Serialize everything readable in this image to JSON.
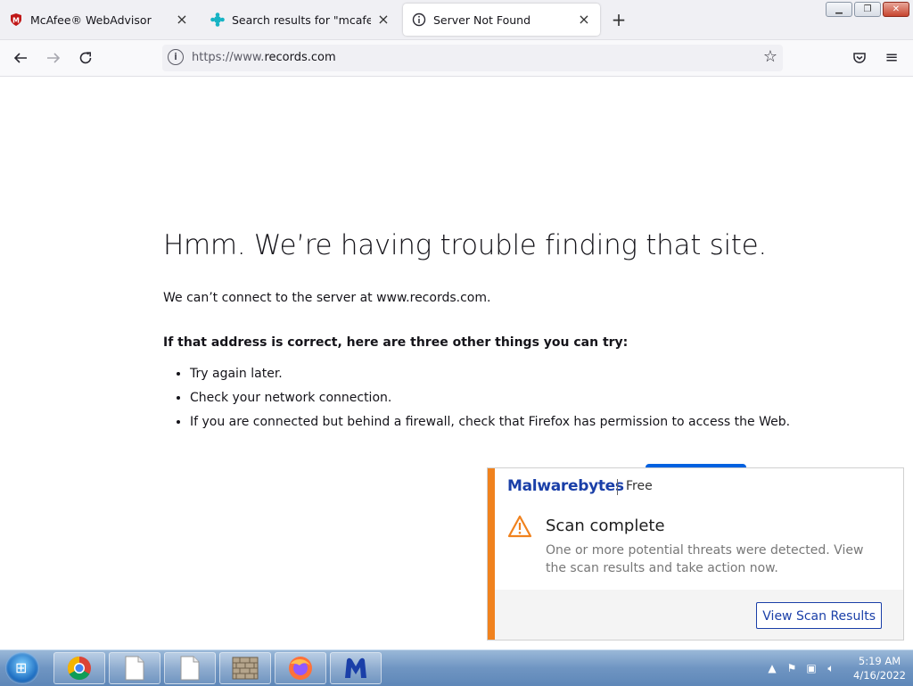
{
  "browser": {
    "tabs": [
      {
        "title": "McAfee® WebAdvisor",
        "favicon": "mcafee-shield-icon",
        "active": false
      },
      {
        "title": "Search results for \"mcafee\" – Ad",
        "favicon": "puzzle-icon",
        "active": false
      },
      {
        "title": "Server Not Found",
        "favicon": "info-circle-icon",
        "active": true
      }
    ],
    "url": {
      "prefix": "https://www.",
      "host": "records.com"
    }
  },
  "error_page": {
    "title": "Hmm. We’re having trouble finding that site.",
    "description": "We can’t connect to the server at www.records.com.",
    "tips_heading": "If that address is correct, here are three other things you can try:",
    "tips": [
      "Try again later.",
      "Check your network connection.",
      "If you are connected but behind a firewall, check that Firefox has permission to access the Web."
    ]
  },
  "notification": {
    "brand": "Malwarebytes",
    "edition": "Free",
    "heading": "Scan complete",
    "body": "One or more potential threats were detected. View the scan results and take action now.",
    "button": "View Scan Results",
    "accent_color": "#f0821e",
    "brand_color": "#1a3fa8"
  },
  "taskbar": {
    "items": [
      "chrome-icon",
      "document-icon",
      "document-icon",
      "firewall-icon",
      "firefox-icon",
      "malwarebytes-icon"
    ],
    "time": "5:19 AM",
    "date": "4/16/2022"
  }
}
